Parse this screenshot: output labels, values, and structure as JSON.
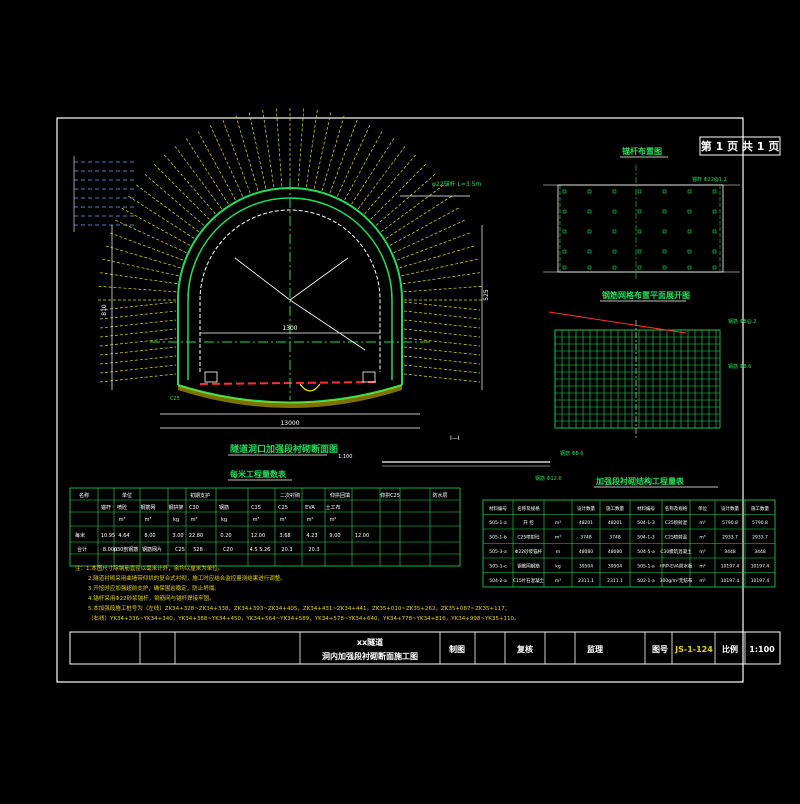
{
  "drawing": {
    "page_label": "第 1 页 共 1 页",
    "project": "xx隧道",
    "drawing_title": "洞内加强段衬砌断面施工图",
    "titleblock": {
      "drawn_label": "制图",
      "review_label": "复核",
      "supervise_label": "监理",
      "figno_label": "图号",
      "figno_value": "JS-1-124",
      "scale_label": "比例",
      "scale_value": "1:100"
    },
    "views": {
      "main_caption": "隧道洞口加强段衬砌断面图",
      "main_caption_scale": "1:100",
      "grid_view_caption": "锚杆布置图",
      "mesh_caption": "钢筋网格布置平面展开图",
      "section_label": "Ⅰ—Ⅰ",
      "qty_table_caption": "加强段衬砌结构工程量表",
      "material_caption": "每米工程量数表"
    },
    "dims": {
      "inner_span": "1300",
      "bottom_total": "13000",
      "left_height": "810",
      "right_height": "525",
      "mesh_spacing_top": "钢筋 Φ8@.2",
      "mesh_spacing_side": "钢筋 Φ8.6",
      "bolt_label": "锚杆 Φ22@1.2",
      "steel_label_1": "φ22锚杆 L=3.5m",
      "steel_label_2": "钢筋 Φ8.6",
      "steel_label_3": "钢筋 Φ12.6"
    }
  },
  "notes": {
    "lines": [
      "注：1.本图尺寸除钢筋直径以毫米计外，余均以厘米为单位。",
      "2.隧道衬砌采用曲墙带仰拱的复合式衬砌，施工时应结合监控量测结果进行调整。",
      "3.开挖时应加强超前支护，确保围岩稳定，防止坍塌。",
      "4.锚杆采用Φ22砂浆锚杆，钢筋网与锚杆焊接牢固。",
      "5.本加强段施工桩号为（左线）ZK34+328~ZK34+338，ZK34+393~ZK34+405，ZK34+431~ZK34+441，ZK35+010~ZK35+262，ZK35+087~ZK35+117；",
      "（右线）YK34+336~YK34+340，YK34+388~YK34+450，YK34+564~YK34+589，YK34+578~YK34+640，YK34+778~YK34+816，YK34+998~YK35+110。"
    ]
  },
  "material_table": {
    "head_top": [
      "名称",
      "单位",
      "初期支护",
      "二次衬砌",
      "仰拱回填",
      "仰拱C25",
      "防水层"
    ],
    "head_sub": [
      "锚杆",
      "喷砼",
      "钢筋网",
      "钢拱架",
      "C30",
      "钢筋",
      "C15",
      "C25",
      "EVA",
      "土工布"
    ],
    "units": [
      "m³",
      "m³",
      "kg",
      "m³",
      "kg",
      "m³",
      "m³",
      "m²",
      "m²"
    ],
    "row1": [
      "每米",
      "10.95",
      "4.64",
      "8.00",
      "3.00",
      "22.80",
      "0.20",
      "12.00",
      "3.68",
      "4.23",
      "9.00",
      "12.00"
    ],
    "row2": [
      "合计",
      "8.000",
      "μ30剖钢筋",
      "钢筋网片",
      "C25",
      "528",
      "C20",
      "4.5 5.26",
      "20.3",
      "20.3"
    ]
  },
  "qty_table": {
    "headers": [
      "材料编号",
      "名称及规格",
      "设计数量",
      "施工数量",
      "材料编号",
      "名称及规格",
      "单位",
      "设计数量",
      "施工数量"
    ],
    "rows": [
      [
        "505-1-a",
        "开 挖",
        "m³",
        "48201",
        "48201",
        "504-1-3",
        "C25喷射混",
        "m³",
        "5790.8",
        "5790.8"
      ],
      [
        "505-1-b",
        "C25喷射砼",
        "m³",
        "3748",
        "3748",
        "504-1-3",
        "C25喷射混",
        "m³",
        "2933.7",
        "2933.7"
      ],
      [
        "505-3-a",
        "Φ22砂浆锚杆",
        "m",
        "48080",
        "48080",
        "504-5-a",
        "C30模筑混凝土",
        "m³",
        "3448",
        "3448"
      ],
      [
        "505-1-c",
        "钢筋网钢筋",
        "kg",
        "39504",
        "39504",
        "505-1-a",
        "HRP-EVA防水板",
        "m²",
        "10197.4",
        "10197.4"
      ],
      [
        "504-2-a",
        "C15片石混凝土",
        "m³",
        "2311.1",
        "2311.1",
        "502-1-a",
        "300g/m²无纺布",
        "m²",
        "10197.4",
        "10197.4"
      ]
    ]
  }
}
